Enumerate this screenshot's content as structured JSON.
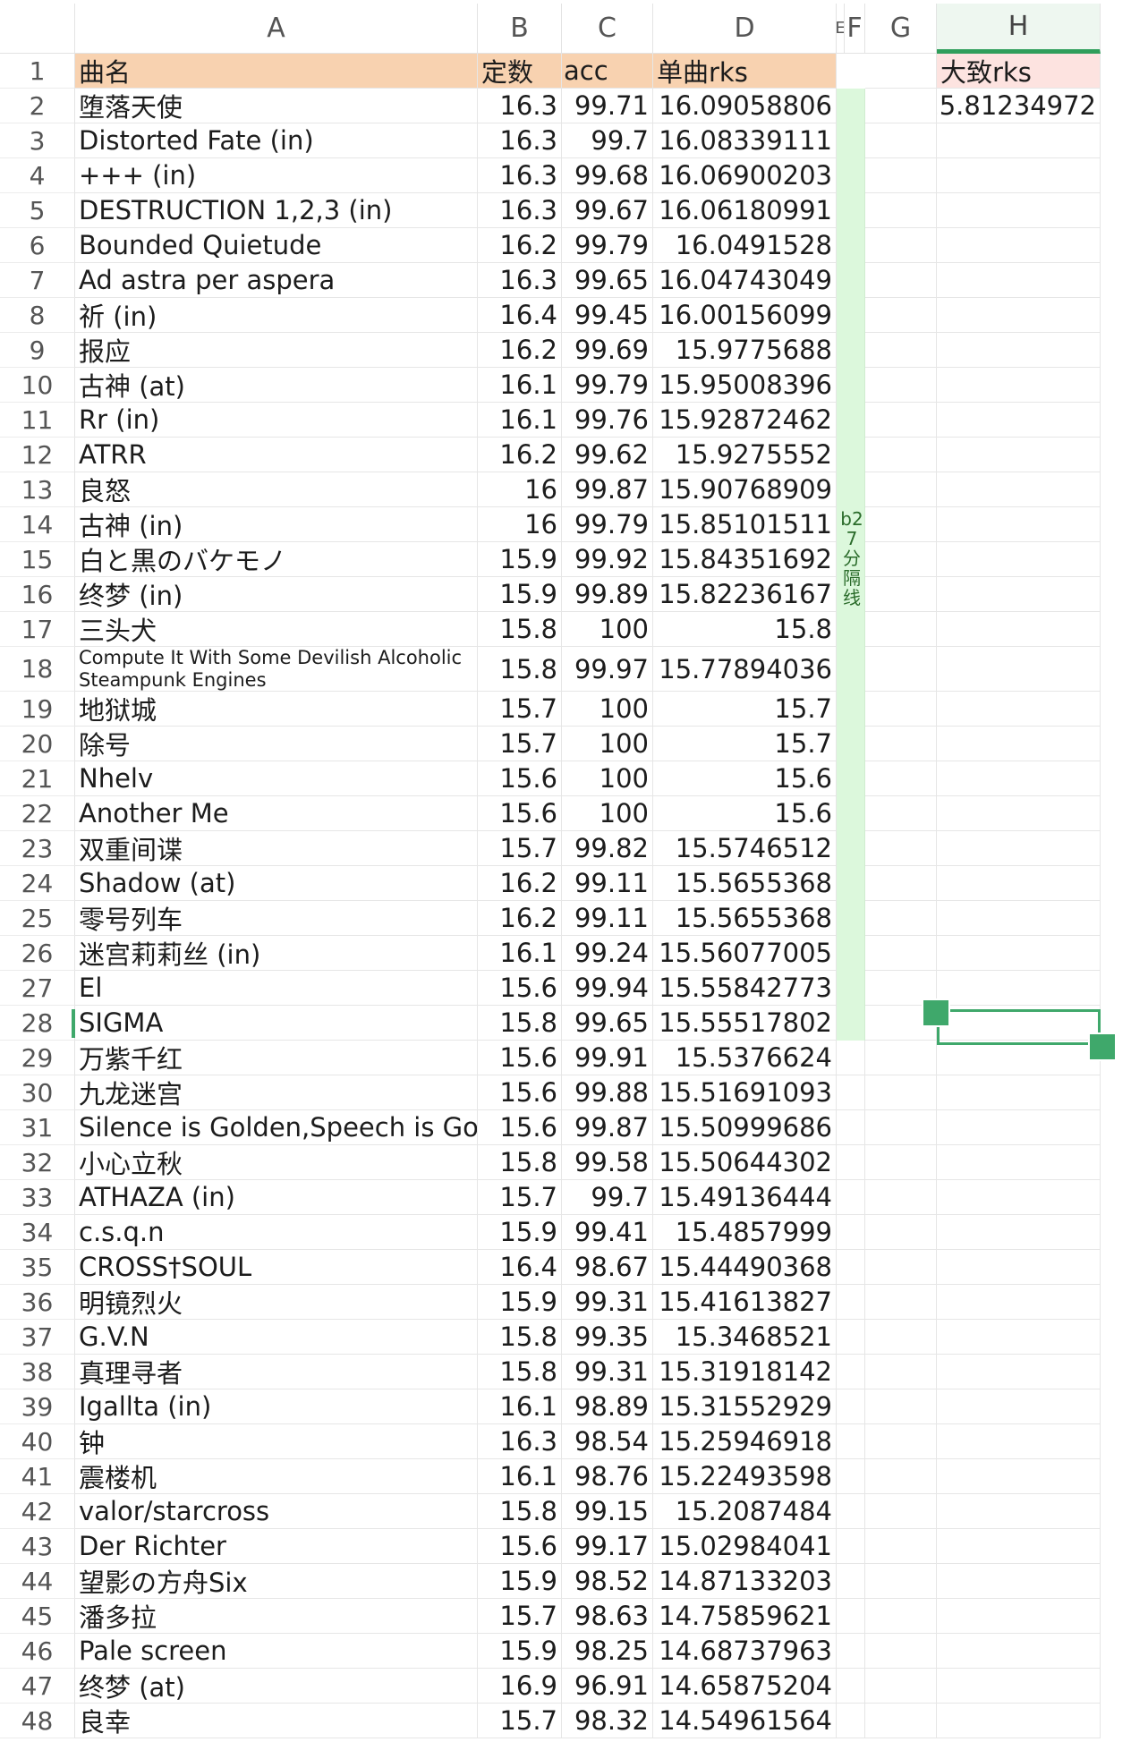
{
  "columns": [
    "A",
    "B",
    "C",
    "D",
    "E",
    "F",
    "G",
    "H"
  ],
  "header": {
    "name": "曲名",
    "const": "定数",
    "acc": "acc",
    "rks": "单曲rks"
  },
  "summary": {
    "label": "大致rks",
    "value": "15.81234972"
  },
  "divider_label": "b27分隔线",
  "colors": {
    "header_fill": "#f8d2b0",
    "summary_fill": "#fde3e0",
    "divider_fill": "#dcf8dc",
    "selection": "#3fa86b"
  },
  "rows": [
    {
      "n": "1"
    },
    {
      "n": "2",
      "name": "堕落天使",
      "c": "16.3",
      "acc": "99.71",
      "rks": "16.09058806"
    },
    {
      "n": "3",
      "name": "Distorted Fate (in)",
      "c": "16.3",
      "acc": "99.7",
      "rks": "16.08339111"
    },
    {
      "n": "4",
      "name": "+++ (in)",
      "c": "16.3",
      "acc": "99.68",
      "rks": "16.06900203"
    },
    {
      "n": "5",
      "name": "DESTRUCTION 1,2,3 (in)",
      "c": "16.3",
      "acc": "99.67",
      "rks": "16.06180991"
    },
    {
      "n": "6",
      "name": "Bounded Quietude",
      "c": "16.2",
      "acc": "99.79",
      "rks": "16.0491528"
    },
    {
      "n": "7",
      "name": "Ad astra per aspera",
      "c": "16.3",
      "acc": "99.65",
      "rks": "16.04743049"
    },
    {
      "n": "8",
      "name": "祈 (in)",
      "c": "16.4",
      "acc": "99.45",
      "rks": "16.00156099"
    },
    {
      "n": "9",
      "name": "报应",
      "c": "16.2",
      "acc": "99.69",
      "rks": "15.9775688"
    },
    {
      "n": "10",
      "name": "古神 (at)",
      "c": "16.1",
      "acc": "99.79",
      "rks": "15.95008396"
    },
    {
      "n": "11",
      "name": "Rr (in)",
      "c": "16.1",
      "acc": "99.76",
      "rks": "15.92872462"
    },
    {
      "n": "12",
      "name": "ATRR",
      "c": "16.2",
      "acc": "99.62",
      "rks": "15.9275552"
    },
    {
      "n": "13",
      "name": "良怒",
      "c": "16",
      "acc": "99.87",
      "rks": "15.90768909"
    },
    {
      "n": "14",
      "name": "古神 (in)",
      "c": "16",
      "acc": "99.79",
      "rks": "15.85101511"
    },
    {
      "n": "15",
      "name": "白と黒のバケモノ",
      "c": "15.9",
      "acc": "99.92",
      "rks": "15.84351692"
    },
    {
      "n": "16",
      "name": "终梦 (in)",
      "c": "15.9",
      "acc": "99.89",
      "rks": "15.82236167"
    },
    {
      "n": "17",
      "name": "三头犬",
      "c": "15.8",
      "acc": "100",
      "rks": "15.8"
    },
    {
      "n": "18",
      "name": "Compute It With Some Devilish Alcoholic Steampunk Engines",
      "c": "15.8",
      "acc": "99.97",
      "rks": "15.77894036"
    },
    {
      "n": "19",
      "name": "地狱城",
      "c": "15.7",
      "acc": "100",
      "rks": "15.7"
    },
    {
      "n": "20",
      "name": "除号",
      "c": "15.7",
      "acc": "100",
      "rks": "15.7"
    },
    {
      "n": "21",
      "name": "Nhelv",
      "c": "15.6",
      "acc": "100",
      "rks": "15.6"
    },
    {
      "n": "22",
      "name": "Another Me",
      "c": "15.6",
      "acc": "100",
      "rks": "15.6"
    },
    {
      "n": "23",
      "name": "双重间谍",
      "c": "15.7",
      "acc": "99.82",
      "rks": "15.5746512"
    },
    {
      "n": "24",
      "name": "Shadow (at)",
      "c": "16.2",
      "acc": "99.11",
      "rks": "15.5655368"
    },
    {
      "n": "25",
      "name": "零号列车",
      "c": "16.2",
      "acc": "99.11",
      "rks": "15.5655368"
    },
    {
      "n": "26",
      "name": "迷宫莉莉丝 (in)",
      "c": "16.1",
      "acc": "99.24",
      "rks": "15.56077005"
    },
    {
      "n": "27",
      "name": "El",
      "c": "15.6",
      "acc": "99.94",
      "rks": "15.55842773"
    },
    {
      "n": "28",
      "name": "SIGMA",
      "c": "15.8",
      "acc": "99.65",
      "rks": "15.55517802"
    },
    {
      "n": "29",
      "name": "万紫千红",
      "c": "15.6",
      "acc": "99.91",
      "rks": "15.5376624"
    },
    {
      "n": "30",
      "name": "九龙迷宫",
      "c": "15.6",
      "acc": "99.88",
      "rks": "15.51691093"
    },
    {
      "n": "31",
      "name": "Silence is Golden,Speech is Golden",
      "c": "15.6",
      "acc": "99.87",
      "rks": "15.50999686"
    },
    {
      "n": "32",
      "name": "小心立秋",
      "c": "15.8",
      "acc": "99.58",
      "rks": "15.50644302"
    },
    {
      "n": "33",
      "name": "ATHAZA (in)",
      "c": "15.7",
      "acc": "99.7",
      "rks": "15.49136444"
    },
    {
      "n": "34",
      "name": "c.s.q.n",
      "c": "15.9",
      "acc": "99.41",
      "rks": "15.4857999"
    },
    {
      "n": "35",
      "name": "CROSS†SOUL",
      "c": "16.4",
      "acc": "98.67",
      "rks": "15.44490368"
    },
    {
      "n": "36",
      "name": "明镜烈火",
      "c": "15.9",
      "acc": "99.31",
      "rks": "15.41613827"
    },
    {
      "n": "37",
      "name": "G.V.N",
      "c": "15.8",
      "acc": "99.35",
      "rks": "15.3468521"
    },
    {
      "n": "38",
      "name": "真理寻者",
      "c": "15.8",
      "acc": "99.31",
      "rks": "15.31918142"
    },
    {
      "n": "39",
      "name": "Igallta (in)",
      "c": "16.1",
      "acc": "98.89",
      "rks": "15.31552929"
    },
    {
      "n": "40",
      "name": "钟",
      "c": "16.3",
      "acc": "98.54",
      "rks": "15.25946918"
    },
    {
      "n": "41",
      "name": "震楼机",
      "c": "16.1",
      "acc": "98.76",
      "rks": "15.22493598"
    },
    {
      "n": "42",
      "name": "valor/starcross",
      "c": "15.8",
      "acc": "99.15",
      "rks": "15.2087484"
    },
    {
      "n": "43",
      "name": "Der Richter",
      "c": "15.6",
      "acc": "99.17",
      "rks": "15.02984041"
    },
    {
      "n": "44",
      "name": "望影の方舟Six",
      "c": "15.9",
      "acc": "98.52",
      "rks": "14.87133203"
    },
    {
      "n": "45",
      "name": "潘多拉",
      "c": "15.7",
      "acc": "98.63",
      "rks": "14.75859621"
    },
    {
      "n": "46",
      "name": "Pale screen",
      "c": "15.9",
      "acc": "98.25",
      "rks": "14.68737963"
    },
    {
      "n": "47",
      "name": "终梦 (at)",
      "c": "16.9",
      "acc": "96.91",
      "rks": "14.65875204"
    },
    {
      "n": "48",
      "name": "良幸",
      "c": "15.7",
      "acc": "98.32",
      "rks": "14.54961564"
    }
  ]
}
